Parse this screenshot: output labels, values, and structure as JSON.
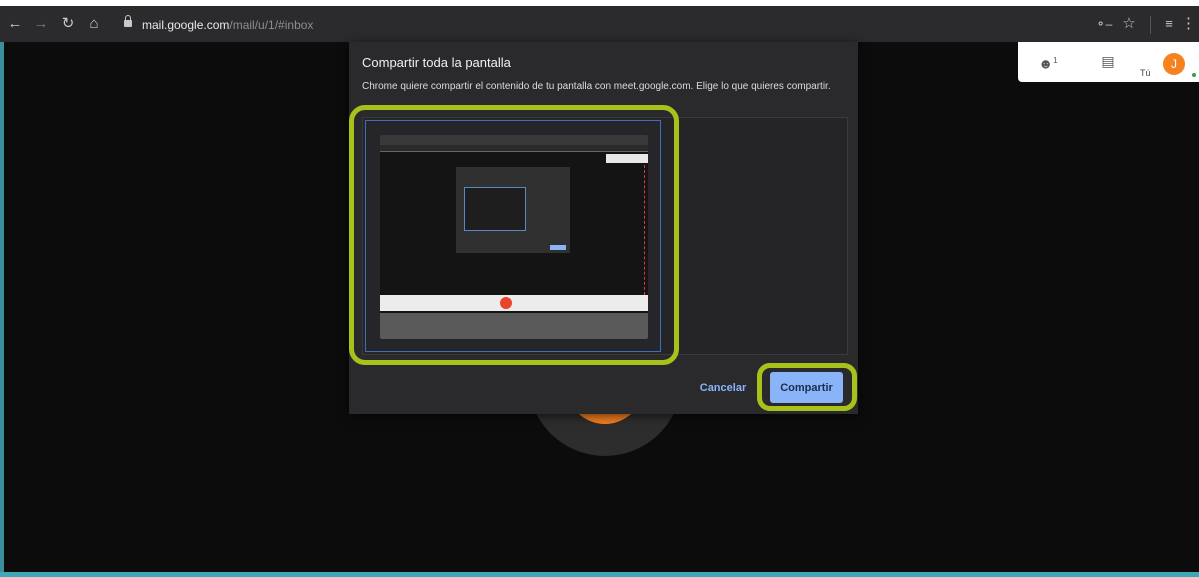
{
  "browser": {
    "url_host": "mail.google.com",
    "url_path": "/mail/u/1/#inbox",
    "icons": [
      "back-arrow-icon",
      "forward-arrow-icon",
      "reload-icon",
      "home-icon",
      "lock-icon",
      "key-icon",
      "star-icon",
      "reading-list-icon",
      "kebab-menu-icon"
    ]
  },
  "meet_panel": {
    "participants_count": "1",
    "you_label": "Tú",
    "avatar_initial": "J",
    "avatar_color": "#f5821f"
  },
  "dialog": {
    "title": "Compartir toda la pantalla",
    "description": "Chrome quiere compartir el contenido de tu pantalla con meet.google.com. Elige lo que quieres compartir.",
    "cancel_label": "Cancelar",
    "share_label": "Compartir"
  },
  "colors": {
    "highlight": "#a8c21c",
    "accent": "#8ab4f8",
    "background": "#0c0c0c"
  }
}
